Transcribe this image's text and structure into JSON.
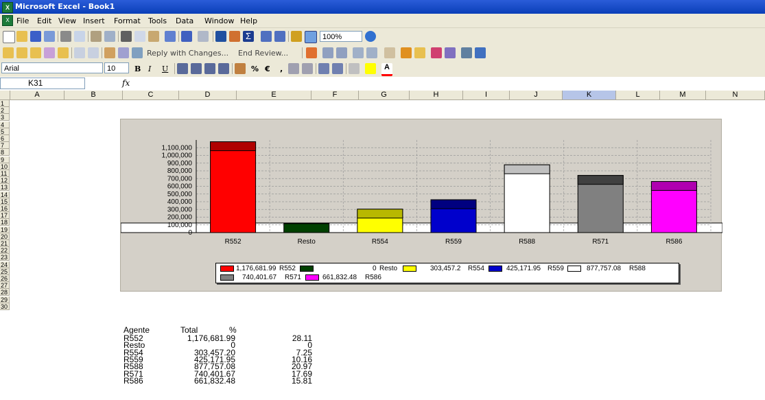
{
  "window": {
    "title": "Microsoft Excel - Book1",
    "app_icon": "excel-icon"
  },
  "menu": [
    "File",
    "Edit",
    "View",
    "Insert",
    "Format",
    "Tools",
    "Data",
    "Window",
    "Help"
  ],
  "toolbar": {
    "zoom": "100%",
    "reply_label": "Reply with Changes...",
    "end_review_label": "End Review..."
  },
  "format_toolbar": {
    "font": "Arial",
    "size": "10",
    "bold": "B",
    "italic": "I",
    "underline": "U",
    "percent": "%",
    "euro": "€",
    "comma": ","
  },
  "formula_bar": {
    "name_box": "K31",
    "fx": "fx",
    "content": ""
  },
  "columns": [
    "A",
    "B",
    "C",
    "D",
    "E",
    "F",
    "G",
    "H",
    "I",
    "J",
    "K",
    "L",
    "M",
    "N"
  ],
  "rows": [
    "1",
    "2",
    "3",
    "4",
    "5",
    "6",
    "7",
    "8",
    "9",
    "10",
    "11",
    "12",
    "13",
    "14",
    "15",
    "16",
    "17",
    "18",
    "19",
    "20",
    "21",
    "22",
    "23",
    "24",
    "25",
    "26",
    "27",
    "28",
    "29",
    "30"
  ],
  "table": {
    "headers": [
      "Agente",
      "Total",
      "%"
    ],
    "rows": [
      [
        "R552",
        "1,176,681.99",
        "28.11"
      ],
      [
        "Resto",
        "0",
        "0"
      ],
      [
        "R554",
        "303,457.20",
        "7.25"
      ],
      [
        "R559",
        "425,171.95",
        "10.16"
      ],
      [
        "R588",
        "877,757.08",
        "20.97"
      ],
      [
        "R571",
        "740,401.67",
        "17.69"
      ],
      [
        "R586",
        "661,832.48",
        "15.81"
      ]
    ]
  },
  "chart_data": {
    "type": "bar",
    "categories": [
      "R552",
      "Resto",
      "R554",
      "R559",
      "R588",
      "R571",
      "R586"
    ],
    "values": [
      1176681.99,
      0,
      303457.2,
      425171.95,
      877757.08,
      740401.67,
      661832.48
    ],
    "colors": [
      "#ff0000",
      "#004000",
      "#ffff00",
      "#0000cc",
      "#ffffff",
      "#808080",
      "#ff00ff"
    ],
    "top_colors": [
      "#b00000",
      "#004000",
      "#b8b800",
      "#000080",
      "#c0c0c0",
      "#404040",
      "#b000b0"
    ],
    "yticks": [
      "0",
      "100,000",
      "200,000",
      "300,000",
      "400,000",
      "500,000",
      "600,000",
      "700,000",
      "800,000",
      "900,000",
      "1,000,000",
      "1,100,000"
    ],
    "ylim": [
      0,
      1200000
    ],
    "legend": [
      {
        "value": "1,176,681.99",
        "name": "R552"
      },
      {
        "value": "",
        "name": ""
      },
      {
        "value": "0",
        "name": "Resto"
      },
      {
        "value": "303,457.2",
        "name": "R554"
      },
      {
        "value": "425,171.95",
        "name": "R559"
      },
      {
        "value": "877,757.08",
        "name": "R588"
      },
      {
        "value": "740,401.67",
        "name": "R571"
      },
      {
        "value": "661,832.48",
        "name": "R586"
      }
    ],
    "legend_placement": "bottom",
    "grid": true,
    "title": "",
    "xlabel": "",
    "ylabel": ""
  }
}
